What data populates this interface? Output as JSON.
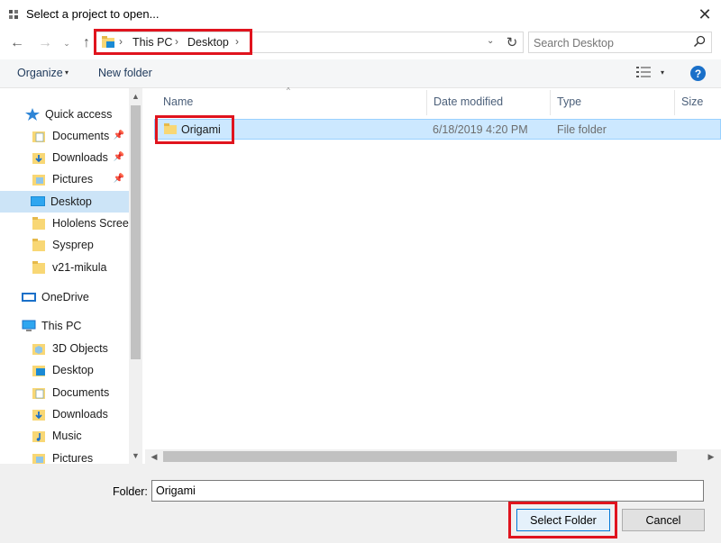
{
  "window": {
    "title": "Select a project to open...",
    "close_glyph": "✕"
  },
  "address_bar": {
    "breadcrumbs": [
      "This PC",
      "Desktop"
    ],
    "separator": "›",
    "dropdown_glyph": "⌄",
    "refresh_glyph": "↻"
  },
  "nav_buttons": {
    "back": "←",
    "forward": "→",
    "recent": "⌄",
    "up": "↑"
  },
  "search": {
    "placeholder": "Search Desktop"
  },
  "toolbar": {
    "organize_label": "Organize",
    "new_folder_label": "New folder",
    "caret": "▾",
    "help_label": "?"
  },
  "nav_pane": {
    "items": [
      {
        "label": "Quick access",
        "icon": "star-icon",
        "pinned": false
      },
      {
        "label": "Documents",
        "icon": "documents-folder-icon",
        "pinned": true
      },
      {
        "label": "Downloads",
        "icon": "downloads-folder-icon",
        "pinned": true
      },
      {
        "label": "Pictures",
        "icon": "pictures-folder-icon",
        "pinned": true
      },
      {
        "label": "Desktop",
        "icon": "desktop-folder-icon",
        "pinned": false,
        "selected": true
      },
      {
        "label": "Hololens Screens",
        "icon": "folder-icon",
        "pinned": false
      },
      {
        "label": "Sysprep",
        "icon": "folder-icon",
        "pinned": false
      },
      {
        "label": "v21-mikula",
        "icon": "folder-icon",
        "pinned": false
      },
      {
        "label": "OneDrive",
        "icon": "onedrive-icon",
        "pinned": false
      },
      {
        "label": "This PC",
        "icon": "computer-icon",
        "pinned": false
      },
      {
        "label": "3D Objects",
        "icon": "3d-objects-icon",
        "pinned": false
      },
      {
        "label": "Desktop",
        "icon": "desktop-folder-icon",
        "pinned": false
      },
      {
        "label": "Documents",
        "icon": "documents-folder-icon",
        "pinned": false
      },
      {
        "label": "Downloads",
        "icon": "downloads-folder-icon",
        "pinned": false
      },
      {
        "label": "Music",
        "icon": "music-folder-icon",
        "pinned": false
      },
      {
        "label": "Pictures",
        "icon": "pictures-folder-icon",
        "pinned": false
      }
    ],
    "pin_glyph": "📌"
  },
  "file_list": {
    "columns": [
      "Name",
      "Date modified",
      "Type",
      "Size"
    ],
    "rows": [
      {
        "name": "Origami",
        "date_modified": "6/18/2019 4:20 PM",
        "type": "File folder",
        "size": ""
      }
    ]
  },
  "scroll": {
    "up": "▲",
    "down": "▼",
    "left": "◀",
    "right": "▶"
  },
  "bottom": {
    "folder_label": "Folder:",
    "folder_value": "Origami",
    "select_button": "Select Folder",
    "cancel_button": "Cancel"
  },
  "colors": {
    "highlight_border": "#e0141e",
    "selection_bg": "#cce8ff",
    "nav_selected_bg": "#cce4f7",
    "accent": "#0078d7",
    "folder_yellow": "#f8d775"
  }
}
